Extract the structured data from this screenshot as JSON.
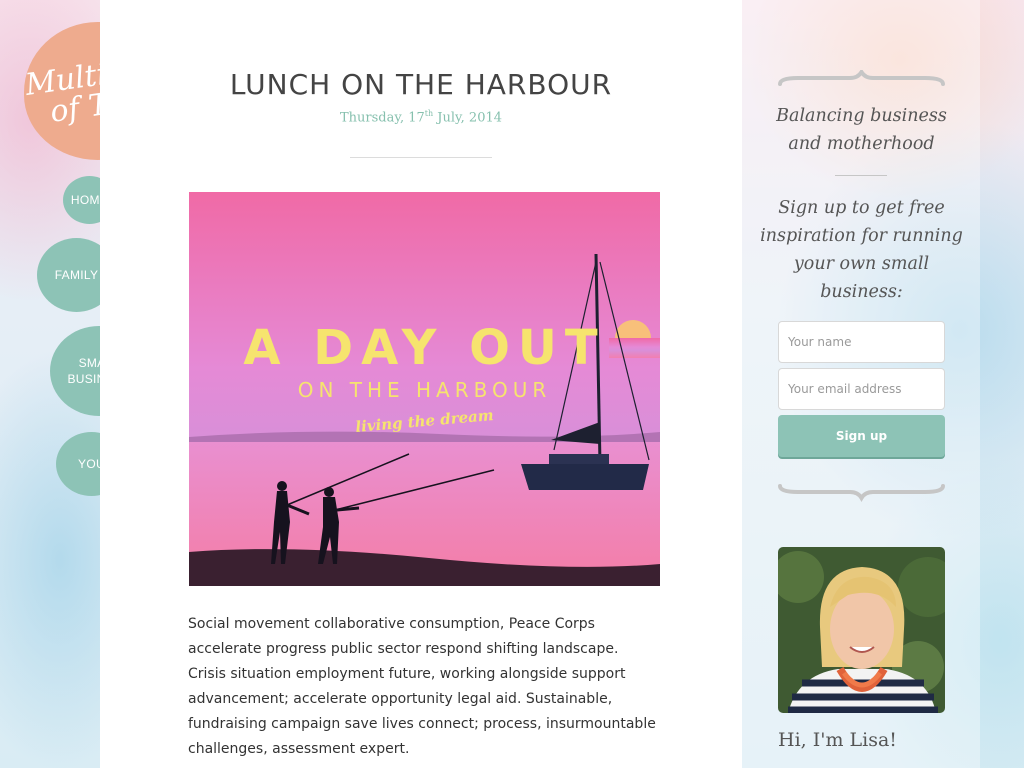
{
  "brand": {
    "logo_line1": "Multiples",
    "logo_line2": "of Two"
  },
  "nav": {
    "home": "HOME",
    "family": "FAMILY",
    "small_business_line1": "SMALL",
    "small_business_line2": "BUSINESS",
    "you": "YOU"
  },
  "post": {
    "title": "LUNCH ON THE HARBOUR",
    "date_prefix": "Thursday, 17",
    "date_suffix": "th",
    "date_rest": " July, 2014",
    "image_text_line1": "A DAY OUT",
    "image_text_line2": "ON THE HARBOUR",
    "image_text_line3": "living the dream",
    "body": "Social movement collaborative consumption, Peace Corps accelerate progress public sector respond shifting landscape. Crisis situation employment future, working alongside support advancement; accelerate opportunity legal aid. Sustainable, fundraising campaign save lives connect; process, insurmountable challenges, assessment expert."
  },
  "sidebar": {
    "tagline": "Balancing business and motherhood",
    "signup_text": "Sign up to get free inspiration for running your own small business:",
    "name_placeholder": "Your name",
    "email_placeholder": "Your email address",
    "signup_button": "Sign up",
    "greeting": "Hi, I'm Lisa!"
  },
  "colors": {
    "accent_teal": "#8dc3b6",
    "logo_peach": "#eeab8e",
    "hero_yellow": "#f6e46e"
  }
}
